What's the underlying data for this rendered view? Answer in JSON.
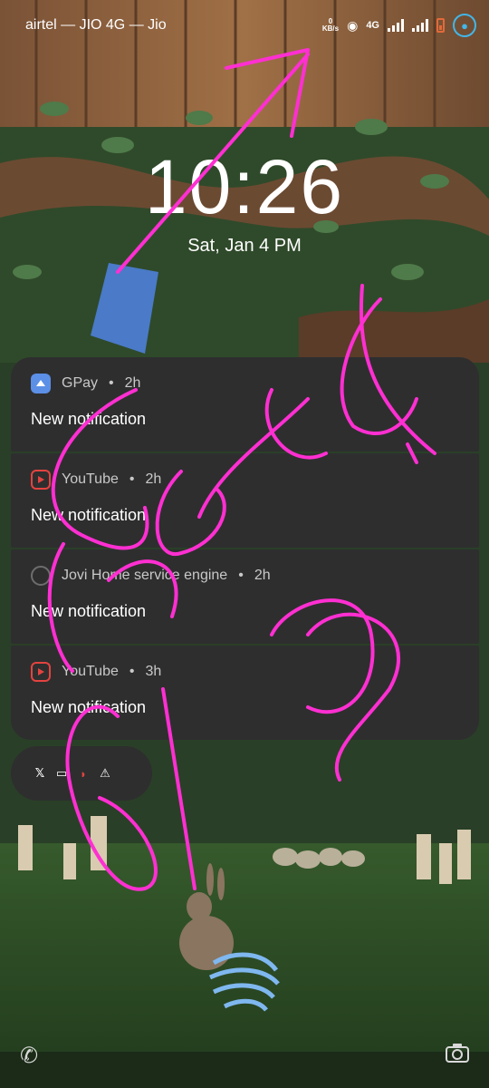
{
  "status_bar": {
    "carrier": "airtel — JIO 4G — Jio",
    "speed_value": "0",
    "speed_unit": "KB/s",
    "network_type": "4G"
  },
  "lock_screen": {
    "time": "10:26",
    "date": "Sat, Jan 4  PM"
  },
  "notifications": [
    {
      "app": "GPay",
      "age": "2h",
      "text": "New notification",
      "icon": "gpay-icon"
    },
    {
      "app": "YouTube",
      "age": "2h",
      "text": "New notification",
      "icon": "youtube-icon"
    },
    {
      "app": "Jovi Home service engine",
      "age": "2h",
      "text": "New notification",
      "icon": "jovi-icon"
    },
    {
      "app": "YouTube",
      "age": "3h",
      "text": "New notification",
      "icon": "youtube-icon"
    }
  ],
  "minimized_apps": [
    {
      "icon": "x-icon",
      "glyph": "𝕏"
    },
    {
      "icon": "paytm-icon",
      "glyph": "▭"
    },
    {
      "icon": "airtel-icon",
      "glyph": "◗"
    },
    {
      "icon": "storage-warning-icon",
      "glyph": "⚠"
    }
  ],
  "colors": {
    "notification_bg": "#2e2e2f",
    "ink": "#ff2fd2",
    "youtube": "#e4433f",
    "gpay": "#5c8fe6"
  }
}
